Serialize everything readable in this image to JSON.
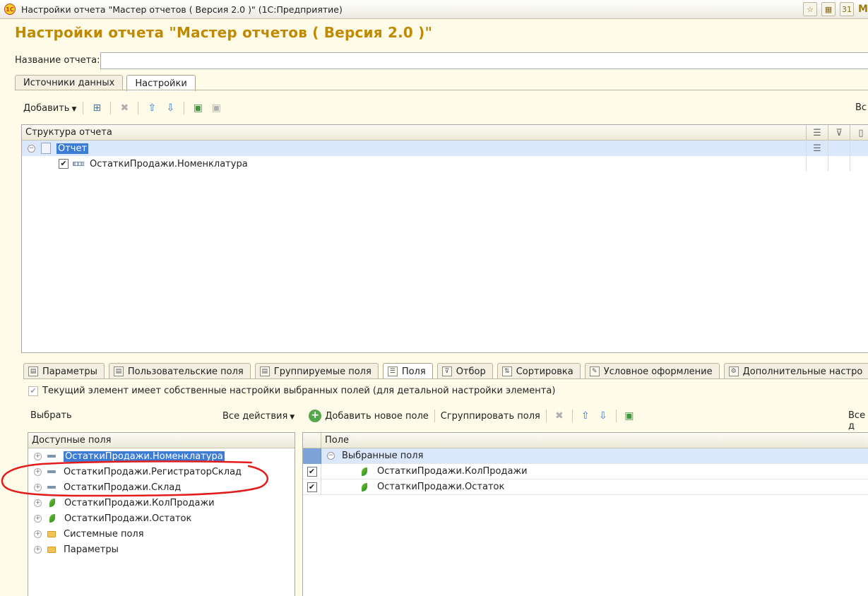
{
  "window": {
    "title": "Настройки отчета \"Мастер отчетов ( Версия 2.0 )\" (1С:Предприятие)",
    "logo": "1С",
    "right_letter": "М"
  },
  "page_title": "Настройки отчета \"Мастер отчетов ( Версия 2.0 )\"",
  "report_name": {
    "label": "Название отчета:",
    "value": ""
  },
  "top_tabs": [
    {
      "label": "Источники данных"
    },
    {
      "label": "Настройки"
    }
  ],
  "toolbar1": {
    "add_label": "Добавить",
    "all_actions": "Вс"
  },
  "structure": {
    "header": "Структура отчета",
    "rows": [
      {
        "label": "Отчет"
      },
      {
        "label": "ОстаткиПродажи.Номенклатура",
        "checked": true
      }
    ]
  },
  "bottom_tabs": [
    {
      "label": "Параметры"
    },
    {
      "label": "Пользовательские поля"
    },
    {
      "label": "Группируемые поля"
    },
    {
      "label": "Поля"
    },
    {
      "label": "Отбор"
    },
    {
      "label": "Сортировка"
    },
    {
      "label": "Условное оформление"
    },
    {
      "label": "Дополнительные настро"
    }
  ],
  "own_settings": {
    "label": "Текущий элемент имеет собственные настройки выбранных полей (для детальной настройки элемента)",
    "checked": true
  },
  "toolbar2": {
    "select_label": "Выбрать",
    "all_actions": "Все действия",
    "add_new_field": "Добавить новое поле",
    "group_fields": "Сгруппировать поля",
    "all_right": "Все д"
  },
  "available_fields": {
    "header": "Доступные поля",
    "items": [
      {
        "label": "ОстаткиПродажи.Номенклатура",
        "icon": "dimension-icon"
      },
      {
        "label": "ОстаткиПродажи.РегистраторСклад",
        "icon": "dimension-icon"
      },
      {
        "label": "ОстаткиПродажи.Склад",
        "icon": "dimension-icon"
      },
      {
        "label": "ОстаткиПродажи.КолПродажи",
        "icon": "resource-icon"
      },
      {
        "label": "ОстаткиПродажи.Остаток",
        "icon": "resource-icon"
      },
      {
        "label": "Системные поля",
        "icon": "folder-icon"
      },
      {
        "label": "Параметры",
        "icon": "folder-icon"
      }
    ]
  },
  "selected_fields": {
    "header": "Поле",
    "group_label": "Выбранные поля",
    "items": [
      {
        "label": "ОстаткиПродажи.КолПродажи",
        "checked": true
      },
      {
        "label": "ОстаткиПродажи.Остаток",
        "checked": true
      }
    ]
  },
  "colors": {
    "title": "#c08a00",
    "selection": "#3d7cd5",
    "annotation": "#e21b1b"
  }
}
